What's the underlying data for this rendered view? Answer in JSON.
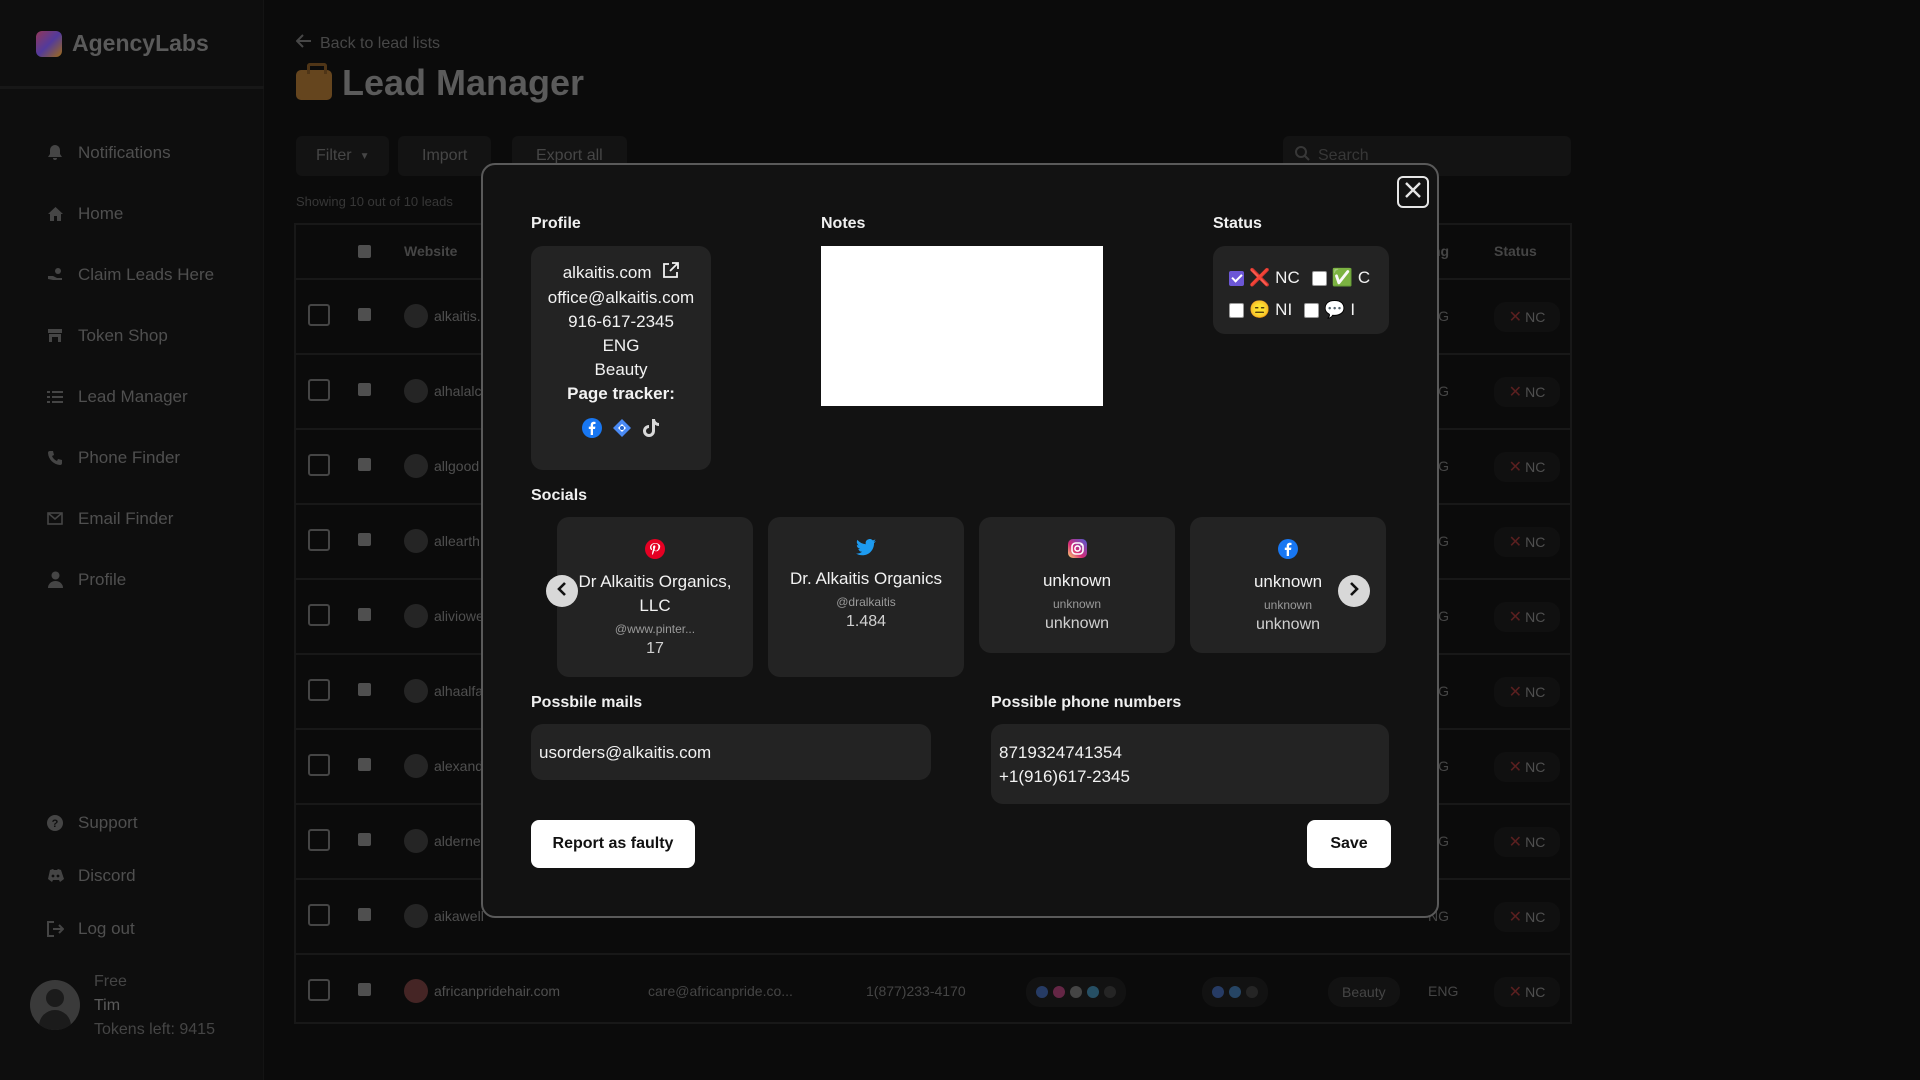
{
  "app": {
    "name": "AgencyLabs"
  },
  "sidebar": {
    "items": [
      {
        "label": "Notifications",
        "icon": "bell-icon"
      },
      {
        "label": "Home",
        "icon": "home-icon"
      },
      {
        "label": "Claim Leads Here",
        "icon": "hand-coin-icon"
      },
      {
        "label": "Token Shop",
        "icon": "shop-icon"
      },
      {
        "label": "Lead Manager",
        "icon": "list-icon"
      },
      {
        "label": "Phone Finder",
        "icon": "phone-icon"
      },
      {
        "label": "Email Finder",
        "icon": "mail-icon"
      },
      {
        "label": "Profile",
        "icon": "user-icon"
      }
    ],
    "bottom_items": [
      {
        "label": "Support",
        "icon": "question-icon"
      },
      {
        "label": "Discord",
        "icon": "discord-icon"
      },
      {
        "label": "Log out",
        "icon": "logout-icon"
      }
    ],
    "user": {
      "plan": "Free",
      "name": "Tim",
      "tokens": "Tokens left: 9415"
    }
  },
  "main": {
    "back_link": "Back to lead lists",
    "title": "Lead Manager",
    "toolbar": {
      "filter": "Filter",
      "import": "Import",
      "export": "Export all",
      "search_placeholder": "Search"
    },
    "showing": "Showing 10 out of 10 leads",
    "columns": {
      "website": "Website",
      "lang": "ng",
      "status": "Status"
    },
    "rows": [
      {
        "site": "alkaitis.",
        "lang": "NG",
        "status": "NC"
      },
      {
        "site": "alhalalc",
        "lang": "NG",
        "status": "NC"
      },
      {
        "site": "allgood",
        "lang": "NG",
        "status": "NC"
      },
      {
        "site": "allearth",
        "lang": "NG",
        "status": "NC"
      },
      {
        "site": "aliviowe",
        "lang": "NG",
        "status": "NC"
      },
      {
        "site": "alhaalfa",
        "lang": "NG",
        "status": "NC"
      },
      {
        "site": "alexand",
        "lang": "NG",
        "status": "NC"
      },
      {
        "site": "alderne",
        "lang": "NG",
        "status": "NC"
      },
      {
        "site": "aikawell",
        "lang": "NG",
        "status": "NC"
      },
      {
        "site": "africanpridehair.com",
        "mail": "care@africanpride.co...",
        "phone": "1(877)233-4170",
        "category": "Beauty",
        "lang": "ENG",
        "status": "NC"
      }
    ]
  },
  "modal": {
    "profile_title": "Profile",
    "profile": {
      "website": "alkaitis.com",
      "email": "office@alkaitis.com",
      "phone": "916-617-2345",
      "language": "ENG",
      "category": "Beauty",
      "page_tracker_label": "Page tracker:"
    },
    "notes_title": "Notes",
    "status_title": "Status",
    "status_options": [
      {
        "label": "NC",
        "checked": true,
        "emoji": "❌"
      },
      {
        "label": "C",
        "checked": false,
        "emoji": "✅"
      },
      {
        "label": "NI",
        "checked": false,
        "emoji": "😑"
      },
      {
        "label": "I",
        "checked": false,
        "emoji": "💬"
      }
    ],
    "socials_title": "Socials",
    "socials": [
      {
        "platform": "pinterest-icon",
        "name": "Dr Alkaitis Organics, LLC",
        "handle": "@www.pinter...",
        "count": "17",
        "color": "#e60023"
      },
      {
        "platform": "twitter-icon",
        "name": "Dr. Alkaitis Organics",
        "handle": "@dralkaitis",
        "count": "1.484",
        "color": "#1d9bf0"
      },
      {
        "platform": "instagram-icon",
        "name": "unknown",
        "handle": "unknown",
        "count": "unknown",
        "color": "#d6249f"
      },
      {
        "platform": "facebook-icon",
        "name": "unknown",
        "handle": "unknown",
        "count": "unknown",
        "color": "#1877f2"
      }
    ],
    "mails_title": "Possbile mails",
    "mails": "usorders@alkaitis.com",
    "phones_title": "Possible phone numbers",
    "phones": [
      "8719324741354",
      "+1(916)617-2345"
    ],
    "report_button": "Report as faulty",
    "save_button": "Save"
  }
}
